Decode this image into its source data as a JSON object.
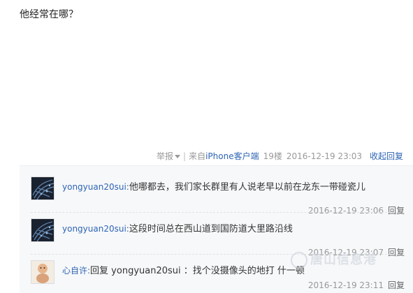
{
  "post": {
    "text": "他经常在哪？",
    "report_label": "举报",
    "client_prefix": "来自",
    "client_name": "iPhone客户端",
    "floor": "19楼",
    "time": "2016-12-19 23:03",
    "collapse_label": "收起回复"
  },
  "replies": [
    {
      "user": "yongyuan20sui:",
      "text": "他哪都去，我们家长群里有人说老早以前在龙东一带碰瓷儿",
      "time": "2016-12-19 23:06",
      "reply_label": "回复"
    },
    {
      "user": "yongyuan20sui:",
      "text": "这段时间总在西山道到国防道大里路沿线",
      "time": "2016-12-19 23:07",
      "reply_label": "回复"
    },
    {
      "user": "心自许:",
      "text": "回复 yongyuan20sui ：找个没摄像头的地打 什一顿",
      "time": "2016-12-19 23:11",
      "reply_label": "回复"
    }
  ],
  "watermark": "唐山信息港",
  "colors": {
    "link": "#2d64b3",
    "meta": "#999999",
    "panel_bg": "#f7f8fa"
  }
}
